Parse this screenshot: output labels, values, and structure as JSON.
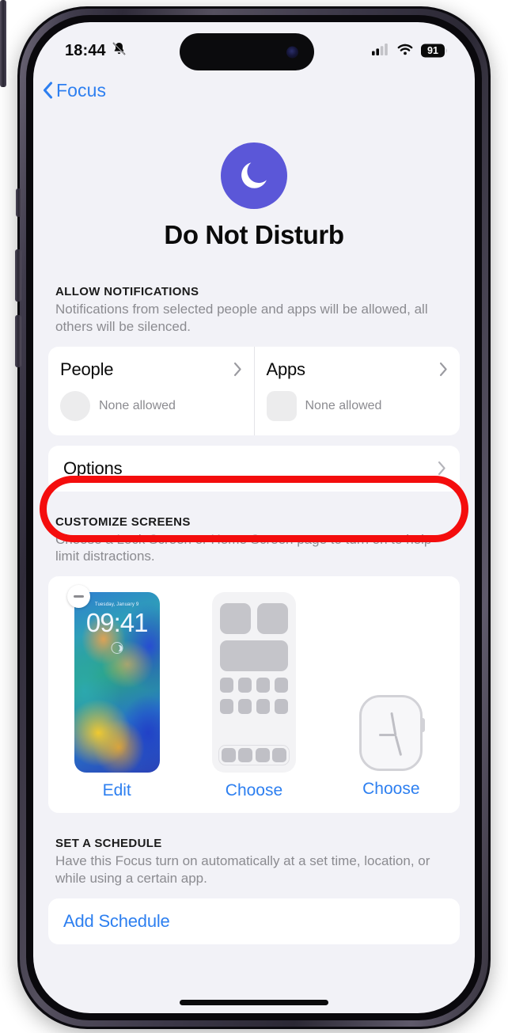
{
  "status_bar": {
    "time": "18:44",
    "mute_icon": "bell-slash-icon",
    "cellular_icon": "cellular-bars-icon",
    "cellular_bars_filled": 2,
    "wifi_icon": "wifi-icon",
    "battery_level": "91"
  },
  "nav": {
    "back_icon": "chevron-left-icon",
    "back_label": "Focus"
  },
  "hero": {
    "icon": "moon-icon",
    "icon_color": "#5b57d8",
    "title": "Do Not Disturb"
  },
  "allow_notifications": {
    "section_title": "ALLOW NOTIFICATIONS",
    "description": "Notifications from selected people and apps will be allowed, all others will be silenced.",
    "cards": [
      {
        "title": "People",
        "subtitle": "None allowed",
        "chevron": "chevron-right-icon",
        "placeholder": "circle"
      },
      {
        "title": "Apps",
        "subtitle": "None allowed",
        "chevron": "chevron-right-icon",
        "placeholder": "square"
      }
    ],
    "options_label": "Options",
    "options_chevron": "chevron-right-icon",
    "highlight_color": "#f40d0d"
  },
  "customize_screens": {
    "section_title": "CUSTOMIZE SCREENS",
    "description": "Choose a Lock Screen or Home Screen page to turn on to help limit distractions.",
    "lock_screen": {
      "remove_badge": "minus-badge-icon",
      "date": "Tuesday, January 9",
      "time": "09:41",
      "widget_icon": "moon-widget-icon",
      "action_label": "Edit"
    },
    "home_screen": {
      "action_label": "Choose"
    },
    "watch_face": {
      "action_label": "Choose"
    }
  },
  "set_schedule": {
    "section_title": "SET A SCHEDULE",
    "description": "Have this Focus turn on automatically at a set time, location, or while using a certain app.",
    "add_label": "Add Schedule"
  },
  "theme": {
    "accent_blue": "#2d7ff0",
    "background": "#f2f2f7",
    "card": "#ffffff"
  }
}
